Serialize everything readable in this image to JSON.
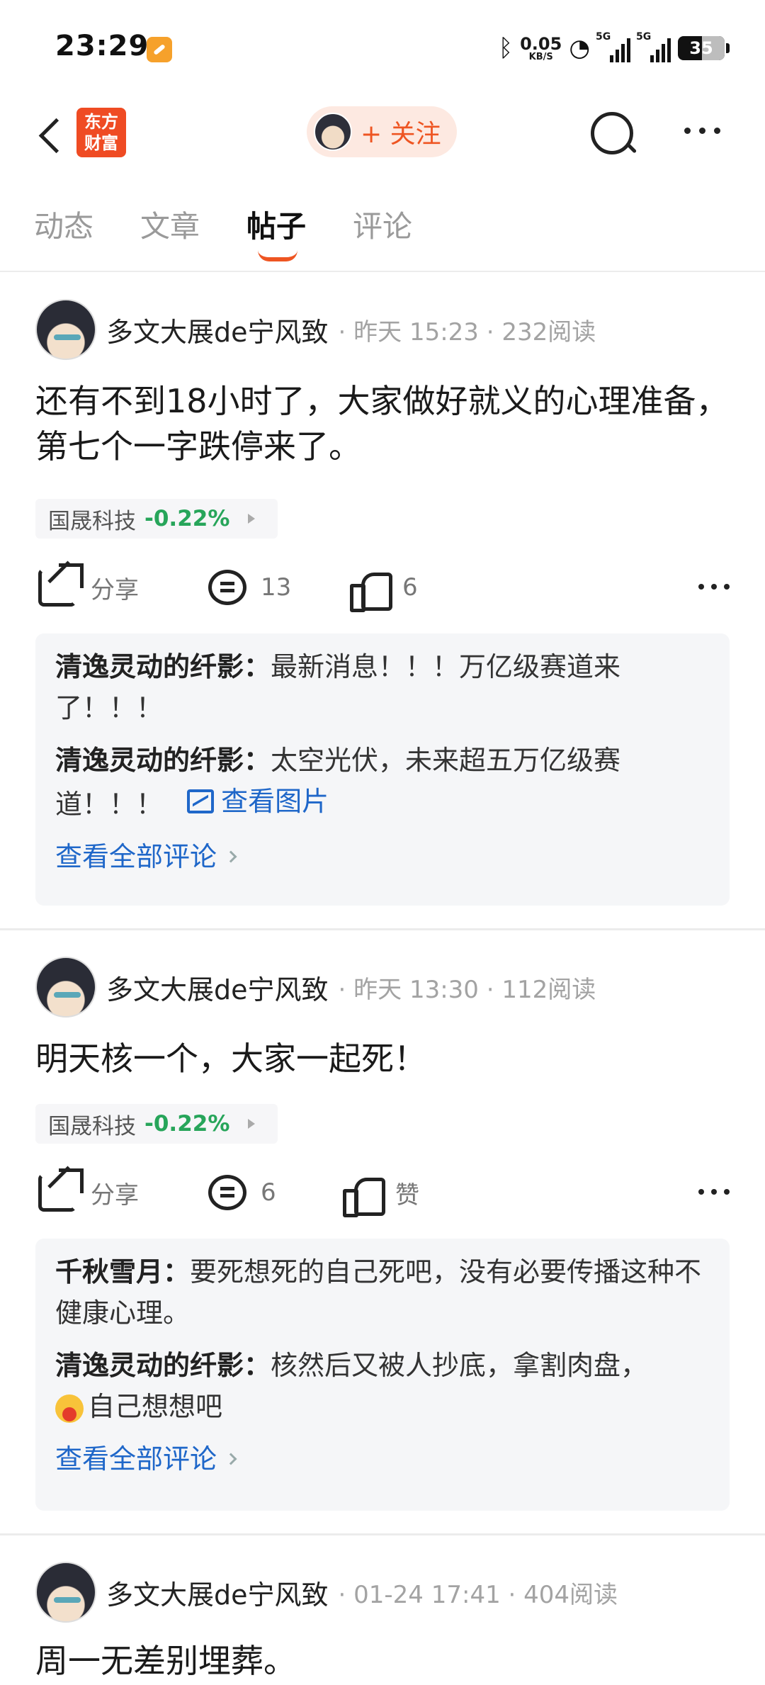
{
  "status_bar": {
    "time": "23:29",
    "net_speed": "0.05",
    "net_unit": "KB/S",
    "signal1": "5G",
    "signal2": "5G",
    "battery": "35"
  },
  "header": {
    "back_icon": "back-arrow-icon",
    "logo_line1": "东方",
    "logo_line2": "财富",
    "follow_label": "+ 关注",
    "search_icon": "search-icon",
    "more_icon": "more-icon"
  },
  "tabs": [
    "动态",
    "文章",
    "帖子",
    "评论"
  ],
  "posts": [
    {
      "author": "多文大展de宁风致",
      "meta": "· 昨天 15:23 · 232阅读",
      "text": "还有不到18小时了，大家做好就义的心理准备，第七个一字跌停来了。",
      "stock": {
        "name": "国晟科技",
        "pct": "-0.22%"
      },
      "share": "分享",
      "comments": "13",
      "likes": "6",
      "replies": [
        {
          "user": "清逸灵动的纤影：",
          "text": "最新消息！！！万亿级赛道来了！！！"
        },
        {
          "user": "清逸灵动的纤影：",
          "text": "太空光伏，未来超五万亿级赛道！！！",
          "link": "查看图片"
        }
      ],
      "view_all": "查看全部评论"
    },
    {
      "author": "多文大展de宁风致",
      "meta": "· 昨天 13:30 · 112阅读",
      "text": "明天核一个，大家一起死！",
      "stock": {
        "name": "国晟科技",
        "pct": "-0.22%"
      },
      "share": "分享",
      "comments": "6",
      "likes": "赞",
      "replies": [
        {
          "user": "千秋雪月：",
          "text": "要死想死的自己死吧，没有必要传播这种不健康心理。"
        },
        {
          "user": "清逸灵动的纤影：",
          "text": "核然后又被人抄底，拿割肉盘，",
          "text2": "自己想想吧"
        }
      ],
      "view_all": "查看全部评论"
    },
    {
      "author": "多文大展de宁风致",
      "meta": "· 01-24 17:41 · 404阅读",
      "text": "周一无差别埋葬。"
    }
  ],
  "colors": {
    "accent": "#ee5522",
    "stock_down": "#27a55a",
    "link": "#1f67c9"
  }
}
